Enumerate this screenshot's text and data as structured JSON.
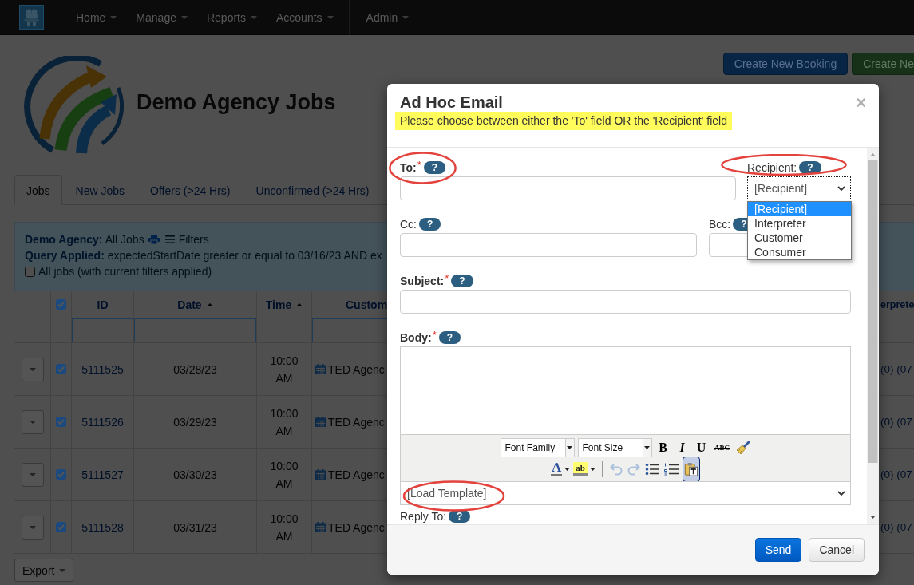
{
  "navbar": {
    "menus": [
      {
        "label": "Home"
      },
      {
        "label": "Manage"
      },
      {
        "label": "Reports"
      },
      {
        "label": "Accounts"
      }
    ],
    "admin_menus": [
      {
        "label": "Admin"
      }
    ]
  },
  "header": {
    "title": "Demo Agency Jobs",
    "actions": [
      {
        "label": "Create New Booking",
        "kind": "primary"
      },
      {
        "label": "Create Ne",
        "kind": "success"
      }
    ]
  },
  "tabs": [
    {
      "label": "Jobs",
      "selected": true
    },
    {
      "label": "New Jobs",
      "selected": false
    },
    {
      "label": "Offers (>24 Hrs)",
      "selected": false
    },
    {
      "label": "Unconfirmed (>24 Hrs)",
      "selected": false
    }
  ],
  "filter_panel": {
    "agency": "**Demo Agency:** All Jobs",
    "filters_link": "Filters",
    "query": "**Query Applied:** expectedStartDate greater or equal to 03/16/23 AND ex",
    "all_jobs_option": {
      "label": "All jobs (with current filters applied)",
      "checked": false
    }
  },
  "table": {
    "select_all": {
      "checked": true
    },
    "columns": [
      {
        "label": "ID",
        "kind": "link",
        "sorted": false,
        "filterable": true
      },
      {
        "label": "Date",
        "kind": "date",
        "sorted": true,
        "filterable": true
      },
      {
        "label": "Time",
        "kind": "time",
        "sorted": true,
        "filterable": false
      },
      {
        "label": "Custom",
        "kind": "event",
        "sorted": false,
        "filterable": true
      },
      {
        "label": "erprete",
        "kind": "text",
        "sorted": false,
        "filterable": false
      }
    ],
    "rows": [
      {
        "checked": true,
        "cells": [
          "5111525",
          "03/28/23",
          "10:00 AM",
          "TED Agenc",
          "(0) (07"
        ]
      },
      {
        "checked": true,
        "cells": [
          "5111526",
          "03/29/23",
          "10:00 AM",
          "TED Agenc",
          "(0) (07"
        ]
      },
      {
        "checked": true,
        "cells": [
          "5111527",
          "03/30/23",
          "10:00 AM",
          "TED Agenc",
          "(0) (07"
        ]
      },
      {
        "checked": true,
        "cells": [
          "5111528",
          "03/31/23",
          "10:00 AM",
          "TED Agenc",
          "(0) (07"
        ]
      }
    ]
  },
  "export": {
    "label": "Export"
  },
  "modal": {
    "title": "Ad Hoc Email",
    "notice": "Please choose between either the 'To' field OR the 'Recipient' field",
    "close": "×",
    "rows": [
      {
        "fields": [
          {
            "kind": "text",
            "label": "To:",
            "required_mark": "*",
            "help": "?",
            "annotated": true
          },
          {
            "kind": "select",
            "label": "Recipient:",
            "help": "?",
            "annotated": true,
            "value": "[Recipient]",
            "expanded": true,
            "options": [
              {
                "label": "[Recipient]",
                "selected": true
              },
              {
                "label": "Interpreter",
                "selected": false
              },
              {
                "label": "Customer",
                "selected": false
              },
              {
                "label": "Consumer",
                "selected": false
              }
            ]
          }
        ]
      },
      {
        "fields": [
          {
            "kind": "text",
            "label": "Cc:",
            "help": "?",
            "annotated": false
          },
          {
            "kind": "text",
            "label": "Bcc:",
            "help": "?",
            "annotated": false
          }
        ]
      },
      {
        "fields": [
          {
            "kind": "text",
            "label": "Subject:",
            "required_mark": "*",
            "help": "?",
            "annotated": false
          }
        ]
      },
      {
        "fields": [
          {
            "kind": "editor",
            "label": "Body:",
            "required_mark": "*",
            "help": "?",
            "annotated": false,
            "toolbar": [
              [
                {
                  "kind": "select",
                  "label": "Font Family"
                },
                {
                  "kind": "select",
                  "label": "Font Size"
                },
                {
                  "kind": "bold",
                  "text": "B",
                  "disabled": false,
                  "active": false
                },
                {
                  "kind": "italic",
                  "text": "I",
                  "disabled": false,
                  "active": false
                },
                {
                  "kind": "underline",
                  "text": "U",
                  "disabled": false,
                  "active": false
                },
                {
                  "kind": "strikethrough",
                  "text": "ABC",
                  "disabled": false,
                  "active": false
                },
                {
                  "kind": "clear-format",
                  "disabled": false,
                  "active": false
                }
              ],
              [
                {
                  "kind": "font-color",
                  "text": "A",
                  "disabled": false,
                  "active": false
                },
                {
                  "kind": "highlight",
                  "text": "ab",
                  "disabled": false,
                  "active": false
                },
                {
                  "kind": "separator"
                },
                {
                  "kind": "undo",
                  "disabled": true,
                  "active": false
                },
                {
                  "kind": "redo",
                  "disabled": true,
                  "active": false
                },
                {
                  "kind": "bullet-list",
                  "disabled": false,
                  "active": false
                },
                {
                  "kind": "numbered-list",
                  "disabled": false,
                  "active": false
                },
                {
                  "kind": "paste-text",
                  "disabled": false,
                  "active": true
                }
              ]
            ]
          }
        ]
      }
    ],
    "template_select": {
      "value": "[Load Template]",
      "annotated": true
    },
    "reply_to": {
      "label": "Reply To:",
      "help": "?"
    },
    "buttons": [
      {
        "label": "Send",
        "kind": "primary"
      },
      {
        "label": "Cancel",
        "kind": "default"
      }
    ]
  }
}
